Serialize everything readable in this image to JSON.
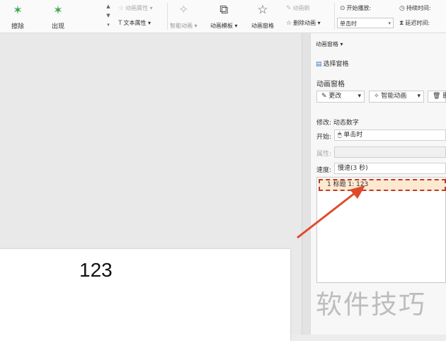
{
  "ribbon": {
    "effects": [
      {
        "label": "擦除",
        "icon": "star-icon"
      },
      {
        "label": "出现",
        "icon": "star-icon"
      }
    ],
    "animation_props": "动画属性",
    "text_props": "文本属性",
    "smart_animation": "智能动画",
    "animation_template": "动画模板",
    "animation_pane": "动画窗格",
    "animation_brush": "动画刷",
    "delete_animation": "删除动画",
    "start_play": "开始播放:",
    "duration": "持续时间:",
    "delay": "延迟时间:",
    "trigger_value": "单击时"
  },
  "canvas": {
    "slide_text": "123"
  },
  "pane": {
    "header": "动画窗格",
    "select_pane": "选择窗格",
    "section_title": "动画窗格",
    "change_button": "更改",
    "smart_animation_button": "智能动画",
    "delete_icon_label": "删",
    "modify_label": "修改: 动态数字",
    "start_label": "开始:",
    "start_value": "单击时",
    "property_label": "属性:",
    "speed_label": "速度:",
    "speed_value": "慢速(3 秒)",
    "list_item": "1  标题 1: 123"
  },
  "watermark": "软件技巧",
  "colors": {
    "accent_star": "#3aa84a",
    "highlight_border": "#c0392b",
    "arrow": "#e04a2a"
  }
}
